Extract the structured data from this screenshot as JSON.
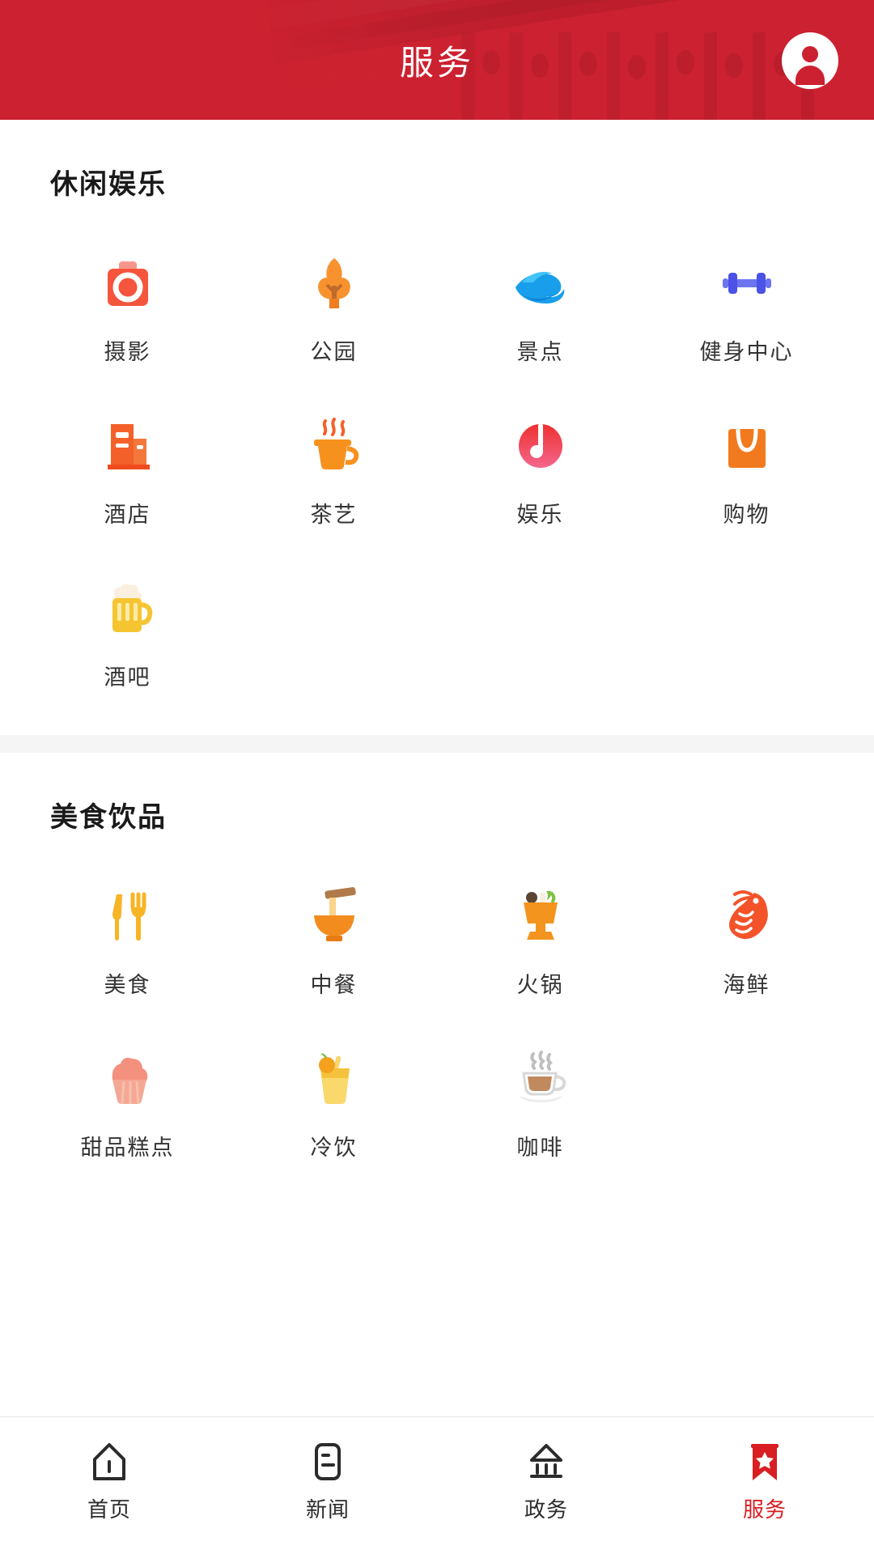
{
  "header": {
    "title": "服务",
    "avatar_icon": "user-avatar-icon",
    "background_color": "#CC2130",
    "title_color": "#FFFFFF"
  },
  "sections": [
    {
      "title": "休闲娱乐",
      "items": [
        {
          "label": "摄影",
          "icon": "camera-icon",
          "color": "#F4553C"
        },
        {
          "label": "公园",
          "icon": "tree-icon",
          "color": "#F7922E"
        },
        {
          "label": "景点",
          "icon": "wave-icon",
          "color": "#189EEA"
        },
        {
          "label": "健身中心",
          "icon": "dumbbell-icon",
          "color": "#4A52E8"
        },
        {
          "label": "酒店",
          "icon": "hotel-icon",
          "color": "#F4602A"
        },
        {
          "label": "茶艺",
          "icon": "teacup-icon",
          "color": "#F7911E"
        },
        {
          "label": "娱乐",
          "icon": "music-note-icon",
          "color": "#EE3E5C"
        },
        {
          "label": "购物",
          "icon": "shopping-bag-icon",
          "color": "#F27A1E"
        },
        {
          "label": "酒吧",
          "icon": "beer-mug-icon",
          "color": "#F5C531"
        }
      ]
    },
    {
      "title": "美食饮品",
      "items": [
        {
          "label": "美食",
          "icon": "fork-knife-icon",
          "color": "#F7B525"
        },
        {
          "label": "中餐",
          "icon": "rice-bowl-icon",
          "color": "#F28C1E"
        },
        {
          "label": "火锅",
          "icon": "hotpot-icon",
          "color": "#F2941E"
        },
        {
          "label": "海鲜",
          "icon": "shrimp-icon",
          "color": "#F4532A"
        },
        {
          "label": "甜品糕点",
          "icon": "cupcake-icon",
          "color": "#F4907E"
        },
        {
          "label": "冷饮",
          "icon": "cold-drink-icon",
          "color": "#F5C23D"
        },
        {
          "label": "咖啡",
          "icon": "coffee-cup-icon",
          "color": "#C08A5E"
        }
      ]
    }
  ],
  "bottom_nav": {
    "active_color": "#D81E22",
    "inactive_color": "#2B2B2B",
    "items": [
      {
        "label": "首页",
        "icon": "home-icon",
        "active": false
      },
      {
        "label": "新闻",
        "icon": "news-icon",
        "active": false
      },
      {
        "label": "政务",
        "icon": "government-icon",
        "active": false
      },
      {
        "label": "服务",
        "icon": "service-bookmark-icon",
        "active": true
      }
    ]
  }
}
